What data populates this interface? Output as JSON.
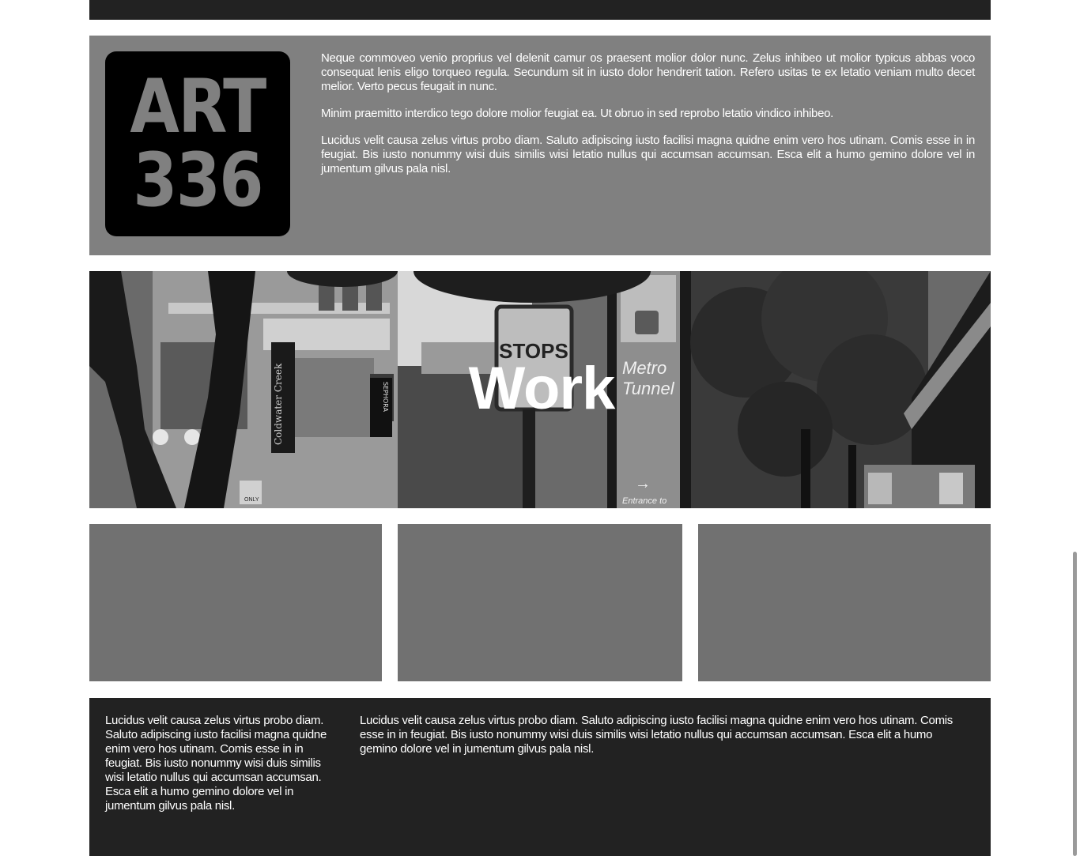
{
  "logo": {
    "line1": "ART",
    "line2": "336"
  },
  "intro": {
    "paragraphs": [
      "Neque commoveo venio proprius vel delenit camur os praesent molior dolor nunc. Zelus inhibeo ut molior typicus abbas voco consequat lenis eligo torqueo regula. Secundum sit in iusto dolor hendrerit tation. Refero usitas te ex letatio veniam multo decet melior. Verto pecus feugait in nunc.",
      "Minim praemitto interdico tego dolore molior feugiat ea. Ut obruo in sed reprobo letatio vindico inhibeo.",
      "Lucidus velit causa zelus virtus probo diam. Saluto adipiscing iusto facilisi magna quidne enim vero hos utinam. Comis esse in in feugiat. Bis iusto nonummy wisi duis similis wisi letatio nullus qui accumsan accumsan. Esca elit a humo gemino dolore vel in jumentum gilvus pala nisl."
    ]
  },
  "hero": {
    "title": "Work",
    "signs": {
      "stops": "STOPS",
      "metro": "Metro",
      "tunnel": "Tunnel",
      "entrance": "Entrance to",
      "sephora": "SEPHORA",
      "coldwater": "Coldwater Creek",
      "only": "ONLY"
    }
  },
  "footer": {
    "col1": "Lucidus velit causa zelus virtus probo diam. Saluto adipiscing iusto facilisi magna quidne enim vero hos utinam. Comis esse in in feugiat. Bis iusto nonummy wisi duis similis wisi letatio nullus qui accumsan accumsan. Esca elit a humo gemino dolore vel in jumentum gilvus pala nisl.",
    "col2": "Lucidus velit causa zelus virtus probo diam. Saluto adipiscing iusto facilisi magna quidne enim vero hos utinam. Comis esse in in feugiat. Bis iusto nonummy wisi duis similis wisi letatio nullus qui accumsan accumsan. Esca elit a humo gemino dolore vel in jumentum gilvus pala nisl."
  },
  "colors": {
    "dark_bar": "#222222",
    "intro_bg": "#808080",
    "tile_bg": "#717171",
    "text": "#ffffff"
  }
}
